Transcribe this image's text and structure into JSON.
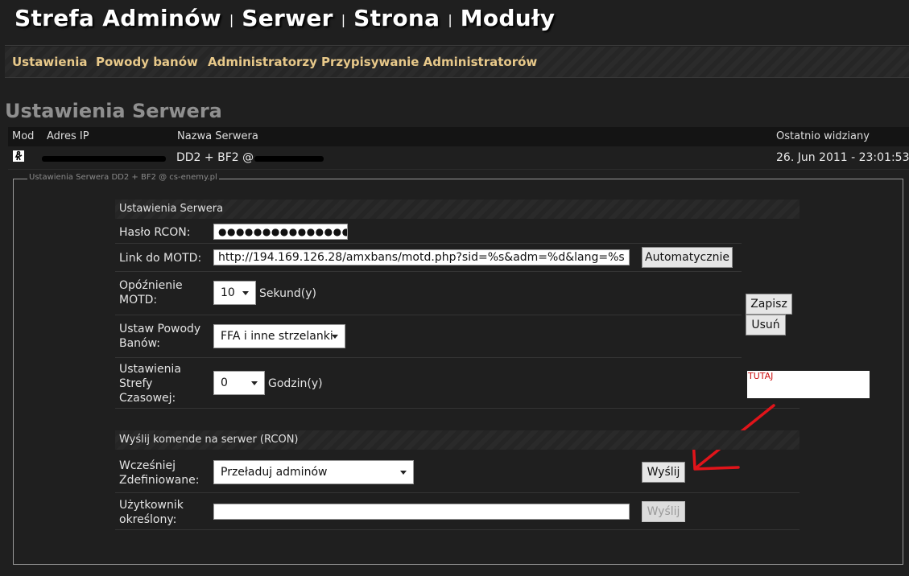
{
  "header": {
    "nav": [
      "Strefa Adminów",
      "Serwer",
      "Strona",
      "Moduły"
    ],
    "separator": "|"
  },
  "subnav": [
    "Ustawienia",
    "Powody banów",
    "Administratorzy",
    "Przypisywanie Administratorów"
  ],
  "page_title": "Ustawienia Serwera",
  "server_table": {
    "headers": [
      "Mod",
      "Adres IP",
      "Nazwa Serwera",
      "Ostatnio widziany"
    ],
    "row": {
      "name_prefix": "DD2 + BF2 @",
      "last_seen": "26. Jun 2011 - 23:01:53"
    }
  },
  "fieldset_legend": "Ustawienia Serwera DD2 + BF2 @ cs-enemy.pl",
  "settings": {
    "section_title": "Ustawienia Serwera",
    "rcon_label": "Hasło RCON:",
    "rcon_value": "●●●●●●●●●●●●●●●●●",
    "motd_label": "Link do MOTD:",
    "motd_value": "http://194.169.126.28/amxbans/motd.php?sid=%s&adm=%d&lang=%s",
    "motd_button": "Automatycznie",
    "delay_label_1": "Opóźnienie",
    "delay_label_2": "MOTD:",
    "delay_value": "10",
    "delay_unit": "Sekund(y)",
    "reasons_label_1": "Ustaw Powody",
    "reasons_label_2": "Banów:",
    "reasons_value": "FFA i inne strzelanki",
    "tz_label_1": "Ustawienia",
    "tz_label_2": "Strefy",
    "tz_label_3": "Czasowej:",
    "tz_value": "0",
    "tz_unit": "Godzin(y)",
    "save_button": "Zapisz",
    "delete_button": "Usuń"
  },
  "note": "TUTAJ",
  "rcon": {
    "section_title": "Wyślij komende na serwer (RCON)",
    "predefined_label_1": "Wcześniej",
    "predefined_label_2": "Zdefiniowane:",
    "predefined_value": "Przeładuj adminów",
    "send_button": "Wyślij",
    "custom_label_1": "Użytkownik",
    "custom_label_2": "określony:",
    "custom_value": "",
    "custom_send_button": "Wyślij"
  },
  "colors": {
    "background": "#1f1f1f",
    "subnav_text": "#e8c98a",
    "title_gray": "#8f8f8f",
    "annotation_red": "#e0141a"
  }
}
